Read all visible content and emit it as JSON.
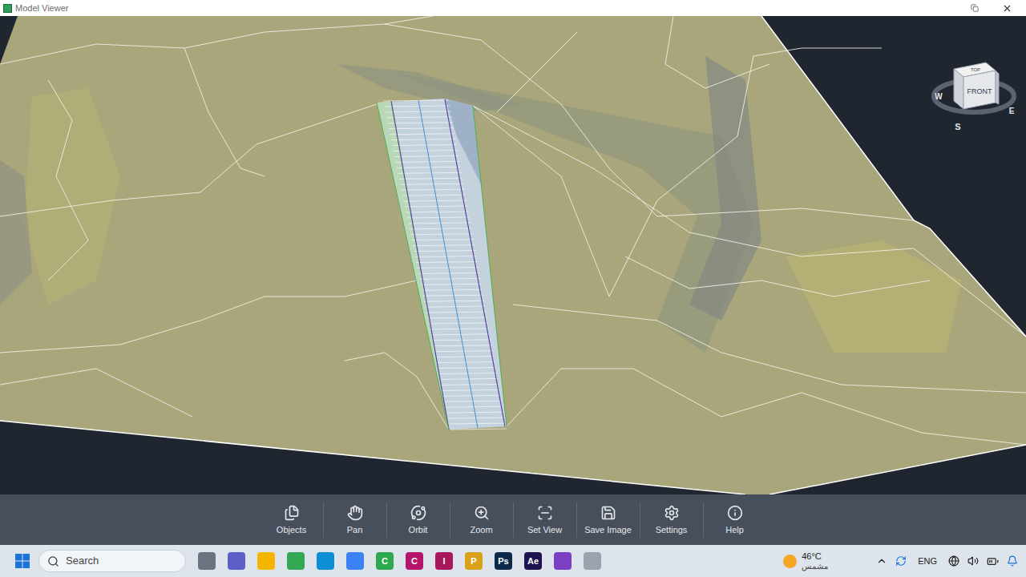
{
  "window": {
    "title": "Model Viewer"
  },
  "viewcube": {
    "top": "TOP",
    "front": "FRONT",
    "west": "W",
    "east": "E",
    "south": "S"
  },
  "toolbar": {
    "buttons": [
      {
        "label": "Objects"
      },
      {
        "label": "Pan"
      },
      {
        "label": "Orbit"
      },
      {
        "label": "Zoom"
      },
      {
        "label": "Set View"
      },
      {
        "label": "Save Image"
      },
      {
        "label": "Settings"
      },
      {
        "label": "Help"
      }
    ]
  },
  "taskbar": {
    "search": {
      "placeholder": "Search"
    },
    "apps": [
      {
        "name": "task-view",
        "label": "",
        "color": "#6b7280"
      },
      {
        "name": "teams",
        "label": "",
        "color": "#5b5fc7"
      },
      {
        "name": "file-explorer",
        "label": "",
        "color": "#f4b400"
      },
      {
        "name": "chrome",
        "label": "",
        "color": "#34a853"
      },
      {
        "name": "edge",
        "label": "",
        "color": "#0c8fd6"
      },
      {
        "name": "store",
        "label": "",
        "color": "#3b82f6"
      },
      {
        "name": "camtasia",
        "label": "C",
        "color": "#2fa84f"
      },
      {
        "name": "civil-3d",
        "label": "C",
        "color": "#b5166b"
      },
      {
        "name": "infraworks",
        "label": "I",
        "color": "#a8175a"
      },
      {
        "name": "arcgis-pro",
        "label": "P",
        "color": "#d9a21b"
      },
      {
        "name": "photoshop",
        "label": "Ps",
        "color": "#0b2a4a"
      },
      {
        "name": "after-effects",
        "label": "Ae",
        "color": "#1f1250"
      },
      {
        "name": "visual-studio",
        "label": "",
        "color": "#7b3fc4"
      },
      {
        "name": "model-viewer",
        "label": "",
        "color": "#9ca3af"
      }
    ],
    "weather": {
      "temperature": "46°C",
      "condition": "مشمس"
    },
    "language": "ENG"
  }
}
